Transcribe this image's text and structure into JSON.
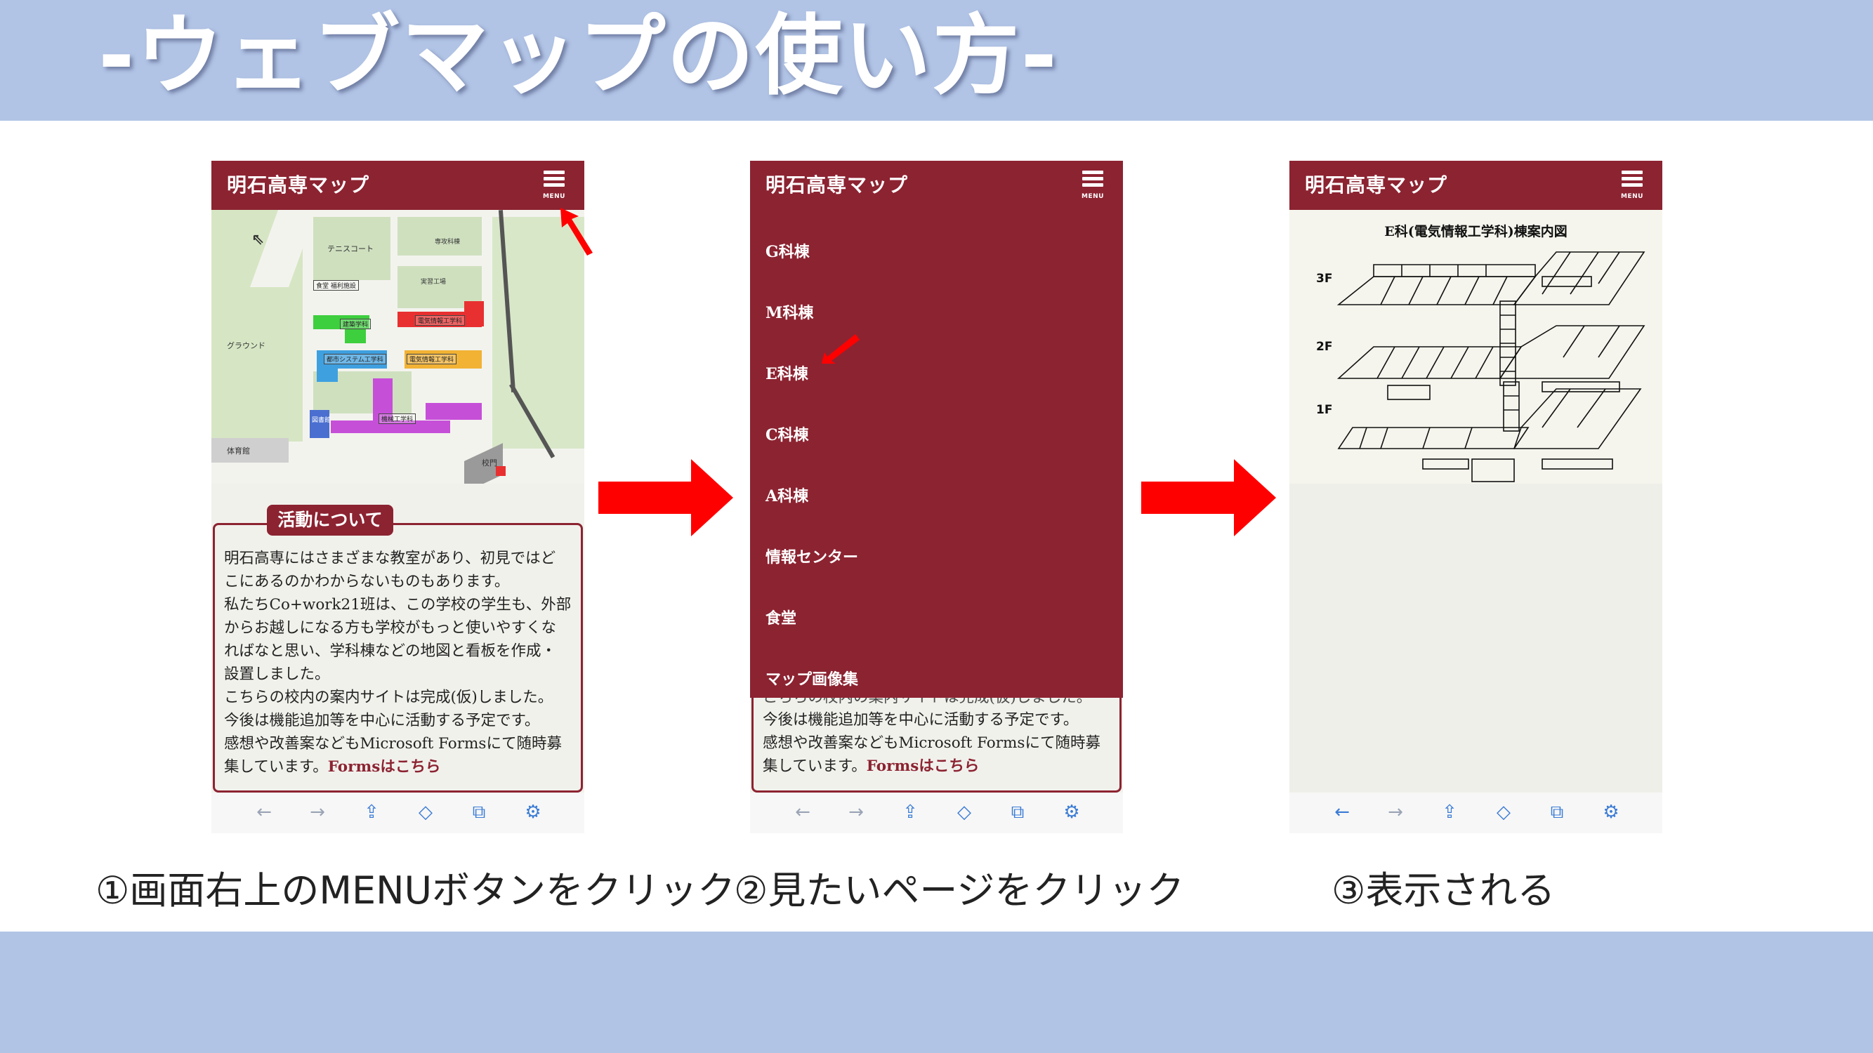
{
  "slide": {
    "title": "-ウェブマップの使い方-"
  },
  "phone_common": {
    "app_title": "明石高専マップ",
    "menu_label": "MENU"
  },
  "screen1": {
    "map": {
      "tennis": "テニスコート",
      "parking": "専攻科棟",
      "cafeteria": "食堂\n福利施設",
      "jikken": "実習工場",
      "ground": "グラウンド",
      "kenchiku": "建築学科",
      "denki": "電気情報工学科",
      "toshi": "都市システム工学科",
      "shiryo": "電気情報工学科",
      "kikai": "機械工学科",
      "taiikukan": "体育館",
      "seimon": "校門",
      "library": "図書館"
    },
    "section_heading": "活動について",
    "paragraph_lines": [
      "明石高専にはさまざまな教室があり、初見ではど",
      "こにあるのかわからないものもあります。",
      "私たちCo+work21班は、この学校の学生も、外部",
      "からお越しになる方も学校がもっと使いやすくな",
      "ればなと思い、学科棟などの地図と看板を作成・",
      "設置しました。",
      "こちらの校内の案内サイトは完成(仮)しました。",
      "今後は機能追加等を中心に活動する予定です。",
      "感想や改善案などもMicrosoft Formsにて随時募",
      "集しています。"
    ],
    "forms_link": "Formsはこちら"
  },
  "screen2": {
    "menu_items": [
      "G科棟",
      "M科棟",
      "E科棟",
      "C科棟",
      "A科棟",
      "情報センター",
      "食堂",
      "マップ画像集"
    ],
    "partial_line": "こちらの校内の案内サイトは完成(仮)しました。",
    "paragraph_lines": [
      "今後は機能追加等を中心に活動する予定です。",
      "感想や改善案などもMicrosoft Formsにて随時募",
      "集しています。"
    ],
    "forms_link": "Formsはこちら"
  },
  "screen3": {
    "floor_title": "E科(電気情報工学科)棟案内図",
    "floors": [
      "3F",
      "2F",
      "1F"
    ]
  },
  "toolbar_icons": [
    "back-arrow-icon",
    "forward-arrow-icon",
    "share-icon",
    "bookmark-icon",
    "tabs-icon",
    "settings-icon"
  ],
  "captions": {
    "step1": "①画面右上のMENUボタンをクリック",
    "step2": "②見たいページをクリック",
    "step3": "③表示される"
  },
  "colors": {
    "band": "#b1c4e6",
    "header": "#8c2331",
    "arrow": "#ff0000",
    "toolbar_icon": "#3a7bd5"
  }
}
